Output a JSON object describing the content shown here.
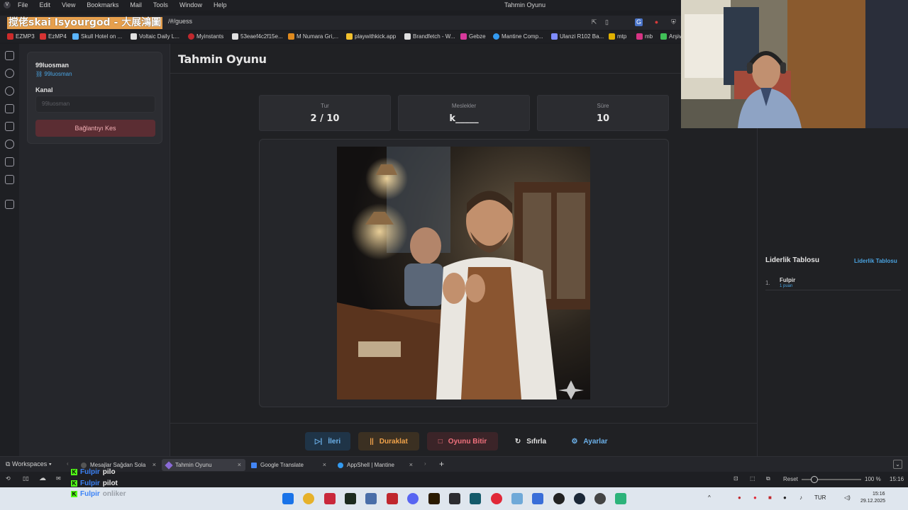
{
  "menubar": {
    "items": [
      "File",
      "Edit",
      "View",
      "Bookmarks",
      "Mail",
      "Tools",
      "Window",
      "Help"
    ],
    "window_title": "Tahmin Oyunu"
  },
  "addressbar": {
    "overlay_title": "搅佬skai Isyourgod - 大展鴻圖",
    "url_suffix": "/#/guess"
  },
  "bookmarks": [
    {
      "label": "EZMP3",
      "color": "#cc2b2b"
    },
    {
      "label": "EzMP4",
      "color": "#d63333"
    },
    {
      "label": "Skull Hotel on ...",
      "color": "#5ab4ff"
    },
    {
      "label": "Voltaic Daily L...",
      "color": "#e0e0e0"
    },
    {
      "label": "Myinstants",
      "color": "#c0282d"
    },
    {
      "label": "53eaef4c2f15e...",
      "color": "#e0e0e0"
    },
    {
      "label": "M Numara Gri,...",
      "color": "#e08a1e"
    },
    {
      "label": "playwithkick.app",
      "color": "#f2c12e"
    },
    {
      "label": "Brandfetch - W...",
      "color": "#e0e0e0"
    },
    {
      "label": "Gebze",
      "color": "#d7399b"
    },
    {
      "label": "Mantine Comp...",
      "color": "#339af0"
    },
    {
      "label": "Ulanzi R102 Ba...",
      "color": "#7f8cff"
    },
    {
      "label": "mtp",
      "color": "#e0b000"
    },
    {
      "label": "mb",
      "color": "#d63384"
    },
    {
      "label": "Arşiv",
      "color": "#40c057"
    }
  ],
  "sidebar_card": {
    "username": "99luosman",
    "link": "99luosman",
    "channel_label": "Kanal",
    "channel_placeholder": "99luosman",
    "disconnect_label": "Bağlantıyı Kes"
  },
  "page_title": "Tahmin Oyunu",
  "stats": [
    {
      "label": "Tur",
      "value": "2 / 10"
    },
    {
      "label": "Meslekler",
      "value": "k_____"
    },
    {
      "label": "Süre",
      "value": "10"
    }
  ],
  "controls": {
    "next": "İleri",
    "pause": "Duraklat",
    "end": "Oyunu Bitir",
    "reset": "Sıfırla",
    "settings": "Ayarlar"
  },
  "leaderboard": {
    "title": "Liderlik Tablosu",
    "link": "Liderlik Tablosu",
    "entries": [
      {
        "rank": "1.",
        "name": "Fulpir",
        "points": "1 puan"
      }
    ]
  },
  "tabs": {
    "workspaces": "Workspaces",
    "items": [
      {
        "label": "Mesajlar Sağdan Sola",
        "color": "#3a3a3a"
      },
      {
        "label": "Tahmin Oyunu",
        "color": "#8a6ad6"
      },
      {
        "label": "Google Translate",
        "color": "#4285f4"
      },
      {
        "label": "AppShell | Mantine",
        "color": "#339af0"
      }
    ]
  },
  "chat": [
    {
      "name": "Fulpir",
      "message": "pilo"
    },
    {
      "name": "Fulpir",
      "message": "pilot"
    },
    {
      "name": "Fulpir",
      "message": "onliker"
    }
  ],
  "statusbar": {
    "reset": "Reset",
    "zoom": "100 %",
    "time": "15:16"
  },
  "taskbar": {
    "lang": "TUR",
    "time": "15:16",
    "date": "29.12.2025"
  }
}
